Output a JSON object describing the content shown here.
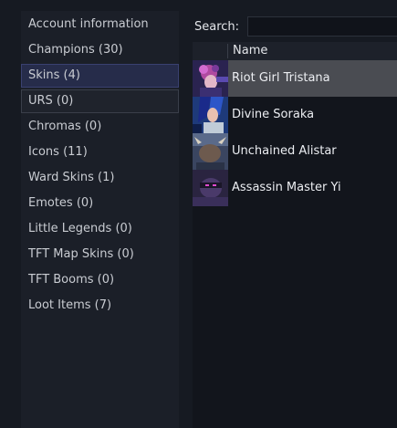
{
  "sidebar": {
    "items": [
      {
        "label": "Account information"
      },
      {
        "label": "Champions (30)"
      },
      {
        "label": "Skins (4)"
      },
      {
        "label": "URS (0)"
      },
      {
        "label": "Chromas (0)"
      },
      {
        "label": "Icons (11)"
      },
      {
        "label": "Ward Skins (1)"
      },
      {
        "label": "Emotes (0)"
      },
      {
        "label": "Little Legends (0)"
      },
      {
        "label": "TFT Map Skins (0)"
      },
      {
        "label": "TFT Booms (0)"
      },
      {
        "label": "Loot Items (7)"
      }
    ]
  },
  "search": {
    "label": "Search:",
    "value": ""
  },
  "grid": {
    "column_name": "Name",
    "rows": [
      {
        "name": "Riot Girl Tristana",
        "thumb_icon": "riot-girl-tristana-portrait"
      },
      {
        "name": "Divine Soraka",
        "thumb_icon": "divine-soraka-portrait"
      },
      {
        "name": "Unchained Alistar",
        "thumb_icon": "unchained-alistar-portrait"
      },
      {
        "name": "Assassin Master Yi",
        "thumb_icon": "assassin-master-yi-portrait"
      }
    ]
  },
  "colors": {
    "background": "#161a22",
    "sidebar": "#1b1f28",
    "active_item": "#262c4a",
    "selected_row": "#4a4c52"
  }
}
